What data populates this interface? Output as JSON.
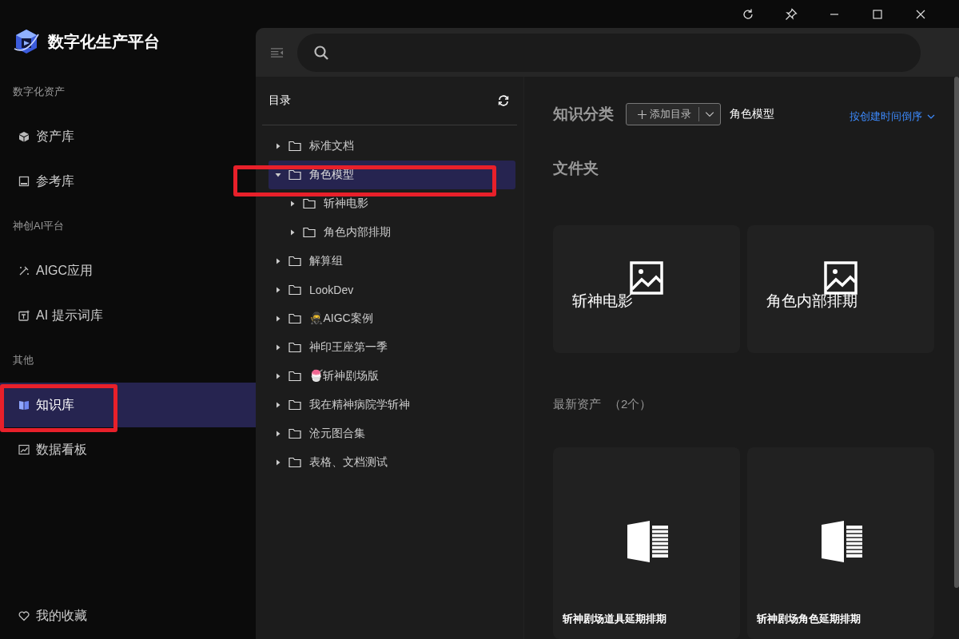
{
  "app": {
    "title": "数字化生产平台"
  },
  "sidebar": {
    "sections": [
      {
        "label": "数字化资产",
        "items": [
          {
            "label": "资产库",
            "selected": false
          },
          {
            "label": "参考库",
            "selected": false
          }
        ]
      },
      {
        "label": "神创AI平台",
        "items": [
          {
            "label": "AIGC应用",
            "selected": false
          },
          {
            "label": "AI 提示词库",
            "selected": false
          }
        ]
      },
      {
        "label": "其他",
        "items": [
          {
            "label": "知识库",
            "selected": true
          },
          {
            "label": "数据看板",
            "selected": false
          }
        ]
      }
    ],
    "footer": {
      "label": "我的收藏"
    }
  },
  "tree": {
    "header": "目录",
    "items": [
      {
        "label": "标准文档",
        "expanded": false,
        "selected": false
      },
      {
        "label": "角色模型",
        "expanded": true,
        "selected": true,
        "children": [
          {
            "label": "斩神电影",
            "expanded": false,
            "selected": false
          },
          {
            "label": "角色内部排期",
            "expanded": false,
            "selected": false
          }
        ]
      },
      {
        "label": "解算组",
        "expanded": false,
        "selected": false
      },
      {
        "label": "LookDev",
        "expanded": false,
        "selected": false
      },
      {
        "label": "🥷AIGC案例",
        "expanded": false,
        "selected": false
      },
      {
        "label": "神印王座第一季",
        "expanded": false,
        "selected": false
      },
      {
        "label": "🍧斩神剧场版",
        "expanded": false,
        "selected": false
      },
      {
        "label": "我在精神病院学斩神",
        "expanded": false,
        "selected": false
      },
      {
        "label": "沧元图合集",
        "expanded": false,
        "selected": false
      },
      {
        "label": "表格、文档测试",
        "expanded": false,
        "selected": false
      }
    ]
  },
  "category": {
    "label": "知识分类",
    "add_button": "添加目录",
    "current": "角色模型",
    "sort": "按创建时间倒序"
  },
  "folders": {
    "title": "文件夹",
    "items": [
      {
        "name": "斩神电影"
      },
      {
        "name": "角色内部排期"
      }
    ]
  },
  "assets": {
    "title": "最新资产",
    "count": "（2个）",
    "items": [
      {
        "name": "斩神剧场道具延期排期"
      },
      {
        "name": "斩神剧场角色延期排期"
      }
    ]
  }
}
